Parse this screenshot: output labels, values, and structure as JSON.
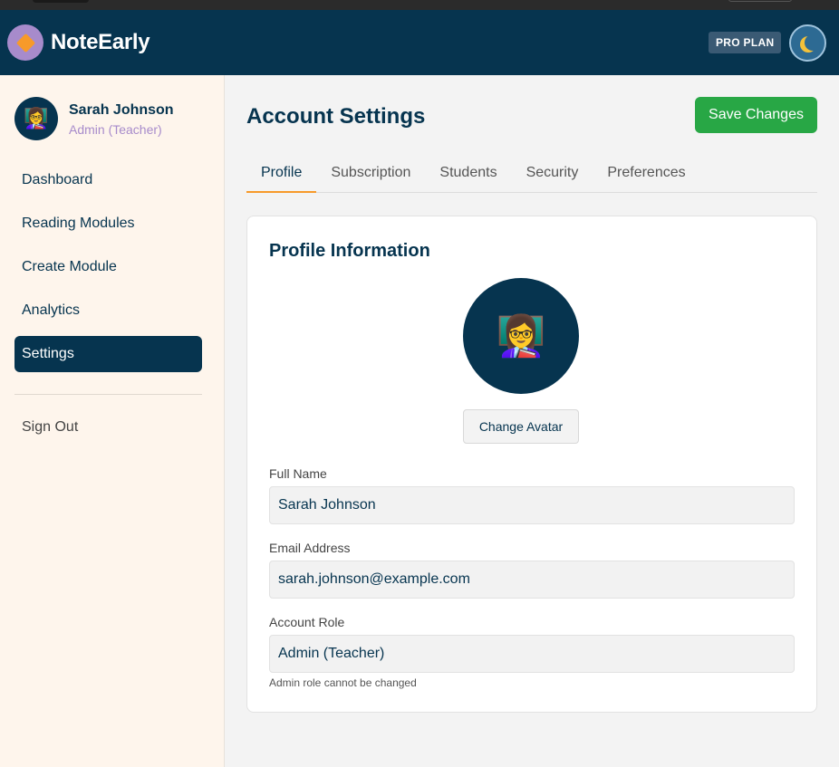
{
  "app": {
    "name": "NoteEarly",
    "plan_badge": "PRO PLAN",
    "theme_icon": "moon-icon",
    "accent_color": "#f79a2a",
    "brand_color": "#06344f"
  },
  "user": {
    "name": "Sarah Johnson",
    "role": "Admin (Teacher)",
    "avatar": "👩‍🏫"
  },
  "sidebar": {
    "items": [
      {
        "label": "Dashboard"
      },
      {
        "label": "Reading Modules"
      },
      {
        "label": "Create Module"
      },
      {
        "label": "Analytics"
      },
      {
        "label": "Settings",
        "active": true
      }
    ],
    "sign_out": "Sign Out"
  },
  "page": {
    "title": "Account Settings",
    "save_label": "Save Changes",
    "save_color": "#28a745"
  },
  "tabs": [
    {
      "label": "Profile",
      "active": true
    },
    {
      "label": "Subscription"
    },
    {
      "label": "Students"
    },
    {
      "label": "Security"
    },
    {
      "label": "Preferences"
    }
  ],
  "profile": {
    "section_title": "Profile Information",
    "change_avatar_label": "Change Avatar",
    "full_name_label": "Full Name",
    "full_name_value": "Sarah Johnson",
    "email_label": "Email Address",
    "email_value": "sarah.johnson@example.com",
    "role_label": "Account Role",
    "role_value": "Admin (Teacher)",
    "role_hint": "Admin role cannot be changed"
  }
}
